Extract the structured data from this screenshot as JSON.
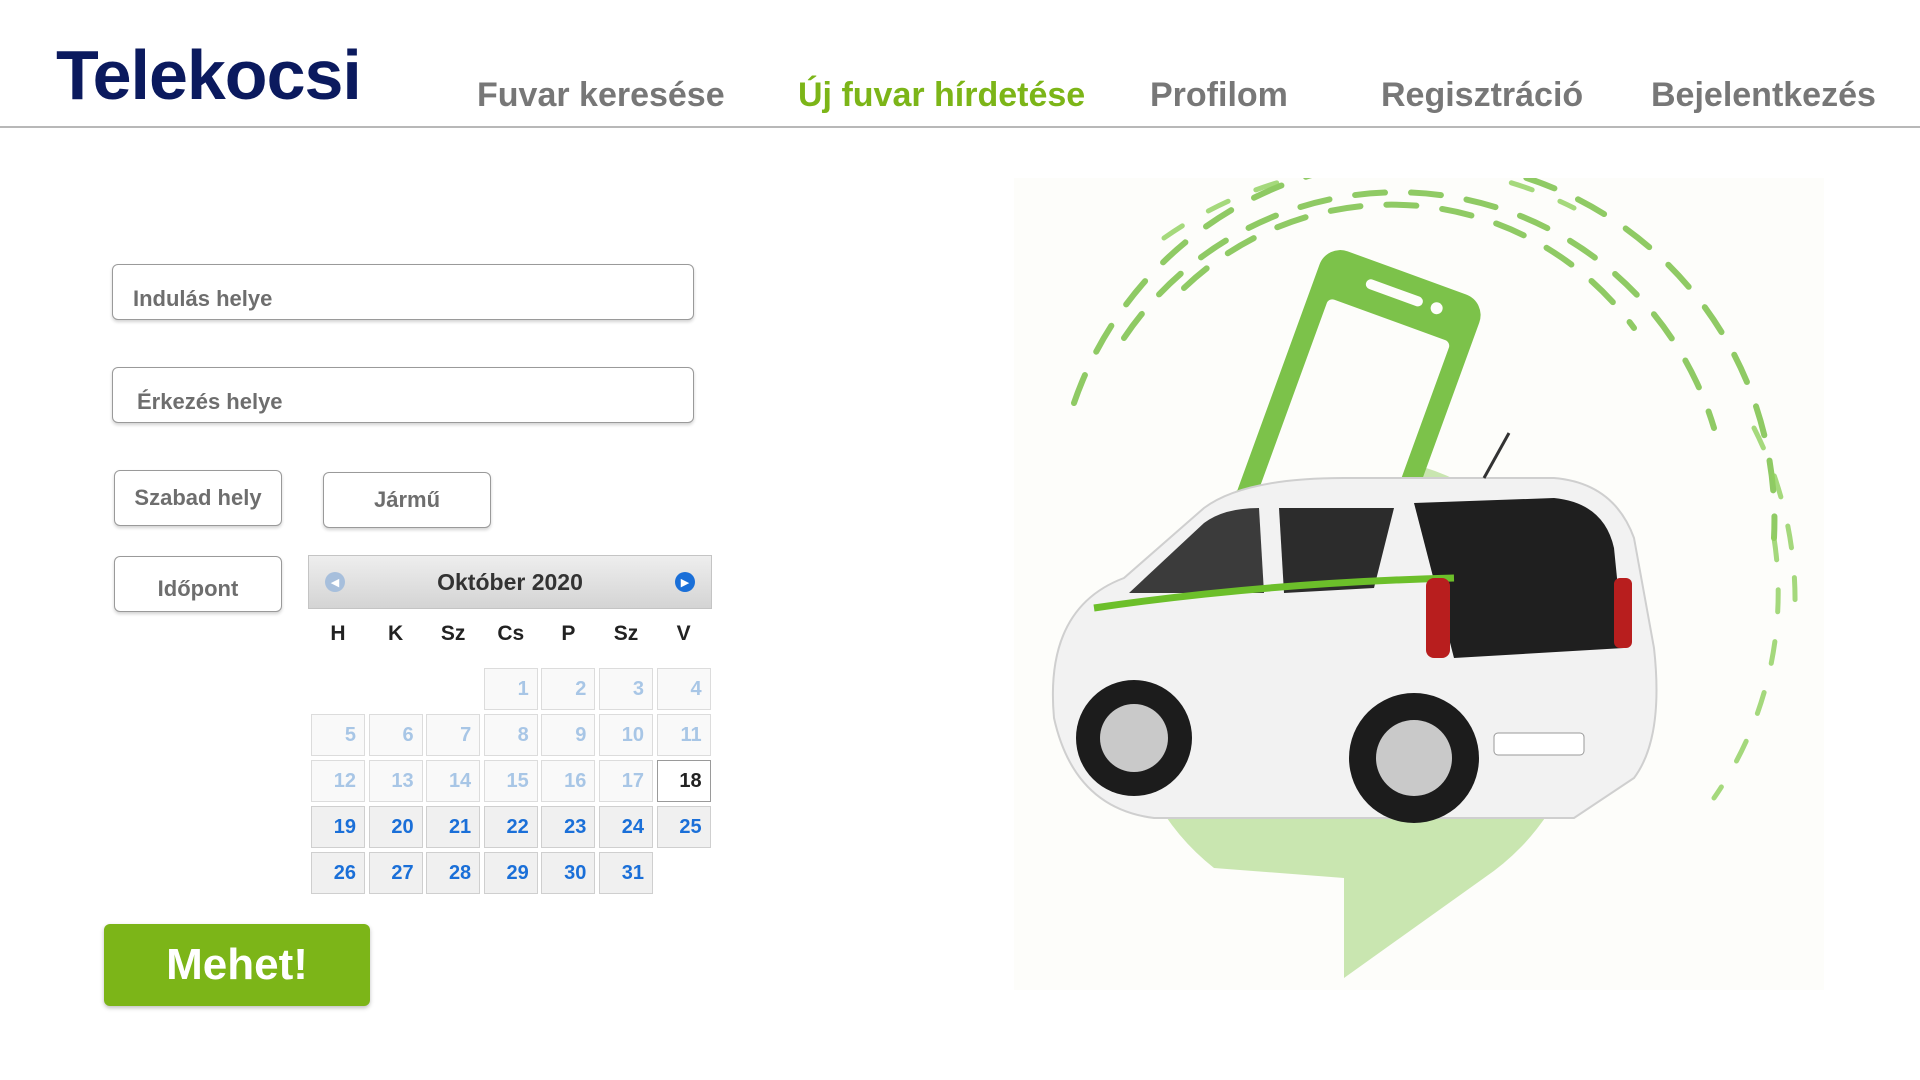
{
  "app": {
    "logo": "Telekocsi"
  },
  "nav": {
    "items": [
      {
        "label": "Fuvar keresése",
        "active": false
      },
      {
        "label": "Új fuvar hírdetése",
        "active": true
      },
      {
        "label": "Profilom",
        "active": false
      },
      {
        "label": "Regisztráció",
        "active": false
      },
      {
        "label": "Bejelentkezés",
        "active": false
      }
    ]
  },
  "form": {
    "departure_placeholder": "Indulás helye",
    "arrival_placeholder": "Érkezés helye",
    "seats_placeholder": "Szabad hely",
    "vehicle_placeholder": "Jármű",
    "time_placeholder": "Időpont",
    "submit_label": "Mehet!"
  },
  "calendar": {
    "title": "Október 2020",
    "weekdays": [
      "H",
      "K",
      "Sz",
      "Cs",
      "P",
      "Sz",
      "V"
    ],
    "today": 18,
    "weeks": [
      [
        "",
        "",
        "",
        "1",
        "2",
        "3",
        "4"
      ],
      [
        "5",
        "6",
        "7",
        "8",
        "9",
        "10",
        "11"
      ],
      [
        "12",
        "13",
        "14",
        "15",
        "16",
        "17",
        "18"
      ],
      [
        "19",
        "20",
        "21",
        "22",
        "23",
        "24",
        "25"
      ],
      [
        "26",
        "27",
        "28",
        "29",
        "30",
        "31",
        ""
      ]
    ]
  },
  "colors": {
    "brand_navy": "#0b1a5e",
    "accent_green": "#7cb518",
    "nav_gray": "#777777",
    "calendar_blue": "#1a6fd8",
    "calendar_past": "#a8c6e6"
  },
  "icons": {
    "calendar_prev": "chevron-left-icon",
    "calendar_next": "chevron-right-icon",
    "illustration": "car-with-phone-illustration"
  }
}
